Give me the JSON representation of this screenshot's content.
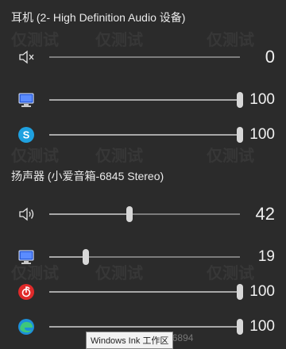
{
  "devices": [
    {
      "name": "耳机 (2- High Definition Audio 设备)",
      "rows": [
        {
          "icon": "speaker-muted-icon",
          "value": "0",
          "level": 0.0,
          "muted": true
        },
        {
          "icon": "monitor-app-icon",
          "value": "100",
          "level": 1.0
        },
        {
          "icon": "skype-icon",
          "value": "100",
          "level": 1.0
        }
      ]
    },
    {
      "name": "扬声器 (小爱音箱-6845 Stereo)",
      "rows": [
        {
          "icon": "speaker-icon",
          "value": "42",
          "level": 0.42
        },
        {
          "icon": "monitor-app-icon",
          "value": "19",
          "level": 0.19
        },
        {
          "icon": "netease-music-icon",
          "value": "100",
          "level": 1.0
        },
        {
          "icon": "edge-icon",
          "value": "100",
          "level": 1.0
        }
      ]
    }
  ],
  "tooltip": "Windows Ink 工作区",
  "watermark_text": "仅测试",
  "attribution": "net/qq_34846894",
  "colors": {
    "background": "#2b2b2b",
    "skype": "#1fa1e0",
    "netease": "#e02a2a",
    "monitor": "#2a5bd7"
  }
}
